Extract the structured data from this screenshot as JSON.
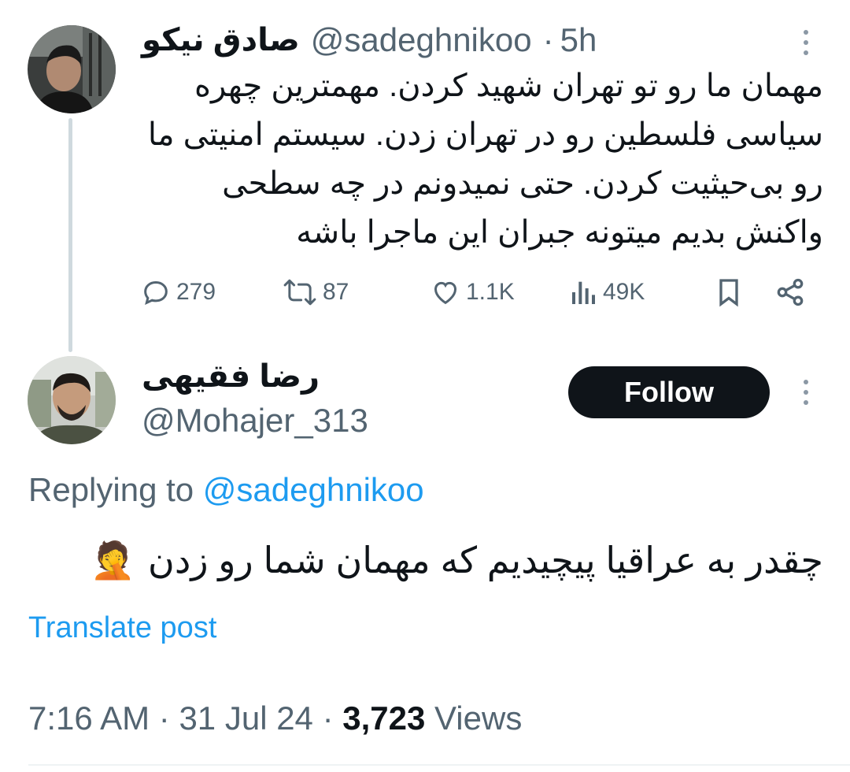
{
  "parent_tweet": {
    "display_name": "صادق نیکو",
    "handle": "@sadeghnikoo",
    "separator": "·",
    "time_ago": "5h",
    "text_lines": [
      "مهمان ما رو تو تهران شهید کردن. مهمترین چهره",
      "سیاسی فلسطین رو در تهران زدن. سیستم امنیتی ما",
      "رو بی‌حیثیت کردن. حتی نمیدونم در چه سطحی",
      "واکنش بدیم میتونه جبران این ماجرا باشه"
    ],
    "actions": {
      "replies": "279",
      "reposts": "87",
      "likes": "1.1K",
      "views": "49K"
    }
  },
  "reply_tweet": {
    "display_name": "رضا فقیهی",
    "handle": "@Mohajer_313",
    "follow_label": "Follow",
    "replying_prefix": "Replying to",
    "replying_to": "@sadeghnikoo",
    "text": "چقدر به عراقیا پیچیدیم که مهمان شما رو زدن",
    "emoji": "🤦",
    "translate_label": "Translate post",
    "meta": {
      "time": "7:16 AM",
      "date": "31 Jul 24",
      "separator": "·",
      "views_count": "3,723",
      "views_label": "Views"
    }
  },
  "colors": {
    "text": "#0f1419",
    "muted": "#536471",
    "link": "#1d9bf0",
    "follow_bg": "#0f1419",
    "thread_line": "#cfd9de"
  }
}
